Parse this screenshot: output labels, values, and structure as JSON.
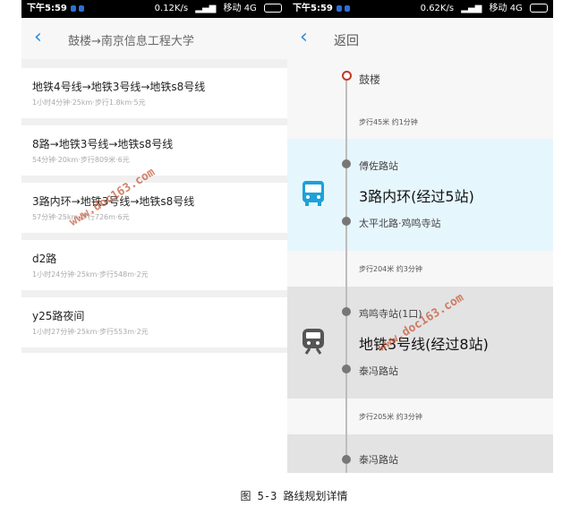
{
  "left_screen": {
    "status": {
      "time": "下午5:59",
      "speed": "0.12K/s",
      "carrier": "移动 4G"
    },
    "header": {
      "title": "鼓楼→南京信息工程大学"
    },
    "routes": [
      {
        "name": "地铁4号线→地铁3号线→地铁s8号线",
        "meta": "1小时4分钟·25km·步行1.8km·5元"
      },
      {
        "name": "8路→地铁3号线→地铁s8号线",
        "meta": "54分钟·20km·步行809米·6元"
      },
      {
        "name": "3路内环→地铁3号线→地铁s8号线",
        "meta": "57分钟·25km·步行726m·6元"
      },
      {
        "name": "d2路",
        "meta": "1小时24分钟·25km·步行548m·2元"
      },
      {
        "name": "y25路夜间",
        "meta": "1小时27分钟·25km·步行553m·2元"
      }
    ]
  },
  "right_screen": {
    "status": {
      "time": "下午5:59",
      "speed": "0.62K/s",
      "carrier": "移动 4G"
    },
    "header": {
      "back_label": "返回"
    },
    "origin": "鼓楼",
    "walk1": "步行45米 约1分钟",
    "bus_segment": {
      "board": "傅佐路站",
      "line": "3路内环(经过5站)",
      "alight": "太平北路·鸡鸣寺站",
      "bg_color": "#e6f6fd",
      "icon_color": "#1da1d8"
    },
    "walk2": "步行204米 约3分钟",
    "metro_segment": {
      "board": "鸡鸣寺站(1口)",
      "line": "地铁3号线(经过8站)",
      "alight": "泰冯路站",
      "bg_color": "#e3e3e3",
      "icon_color": "#555555"
    },
    "walk3": "步行205米 约3分钟",
    "next_stop": "泰冯路站"
  },
  "watermark": "www.doc163.com",
  "caption": "图 5-3 路线规划详情"
}
